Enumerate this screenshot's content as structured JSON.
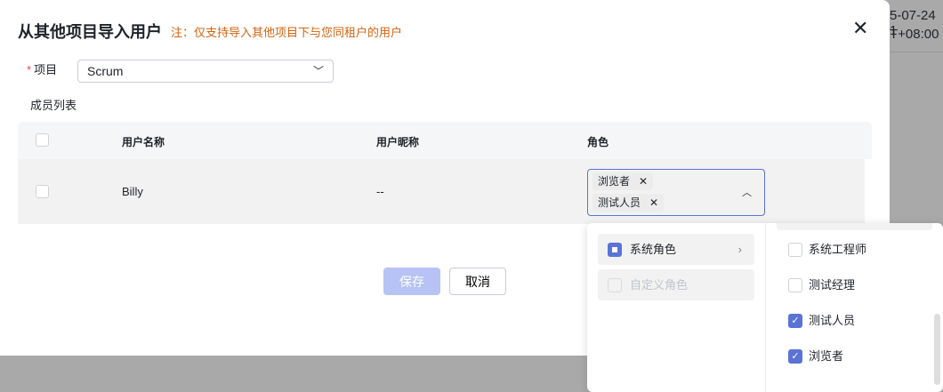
{
  "background": {
    "date": "5-07-24 1",
    "tz": "T+08:00"
  },
  "dialog": {
    "title": "从其他项目导入用户",
    "note": "注：仅支持导入其他项目下与您同租户的用户",
    "close": "✕"
  },
  "project": {
    "label": "项目",
    "required": "*",
    "value": "Scrum"
  },
  "members_label": "成员列表",
  "table": {
    "headers": [
      "用户名称",
      "用户昵称",
      "角色"
    ],
    "rows": [
      {
        "name": "Billy",
        "nickname": "--",
        "roles": [
          "浏览者",
          "测试人员"
        ]
      }
    ]
  },
  "buttons": {
    "save": "保存",
    "cancel": "取消"
  },
  "dropdown": {
    "categories": [
      {
        "label": "系统角色",
        "state": "partial"
      },
      {
        "label": "自定义角色",
        "state": "disabled"
      }
    ],
    "options": [
      {
        "label": "系统工程师",
        "checked": false
      },
      {
        "label": "测试经理",
        "checked": false
      },
      {
        "label": "测试人员",
        "checked": true
      },
      {
        "label": "浏览者",
        "checked": true
      }
    ]
  }
}
